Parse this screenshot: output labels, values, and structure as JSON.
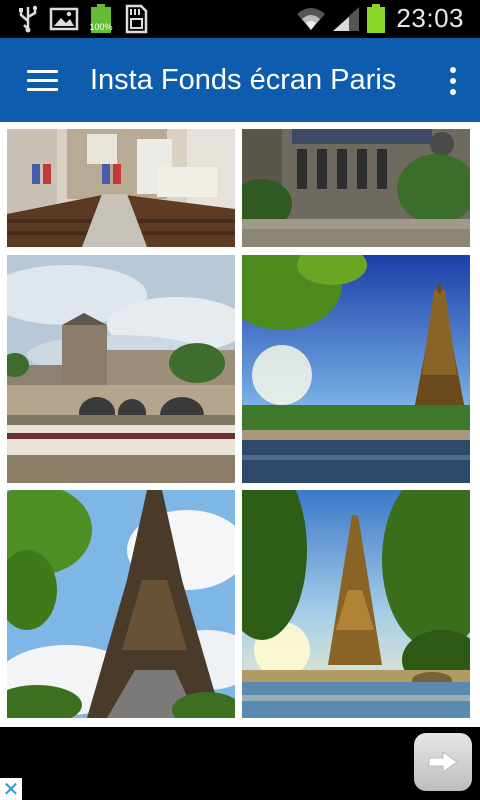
{
  "status_bar": {
    "time": "23:03",
    "battery_percent_label": "100%",
    "icons": [
      "usb-icon",
      "image-icon",
      "battery-full-icon",
      "sd-card-icon",
      "wifi-icon",
      "signal-icon",
      "battery-icon"
    ]
  },
  "app_bar": {
    "title": "Insta Fonds écran Paris",
    "color": "#0d5cad",
    "menu_icon": "hamburger-menu-icon",
    "overflow_icon": "overflow-menu-icon"
  },
  "gallery": {
    "thumbnails": [
      {
        "subject": "church-interior"
      },
      {
        "subject": "gothic-cathedral"
      },
      {
        "subject": "louvre-seine-bridge"
      },
      {
        "subject": "eiffel-tower-seine"
      },
      {
        "subject": "eiffel-tower-closeup"
      },
      {
        "subject": "eiffel-tower-sunset"
      }
    ]
  },
  "ad_bar": {
    "next_icon": "arrow-right-icon",
    "close_icon": "close-icon",
    "close_symbol": "✕"
  }
}
